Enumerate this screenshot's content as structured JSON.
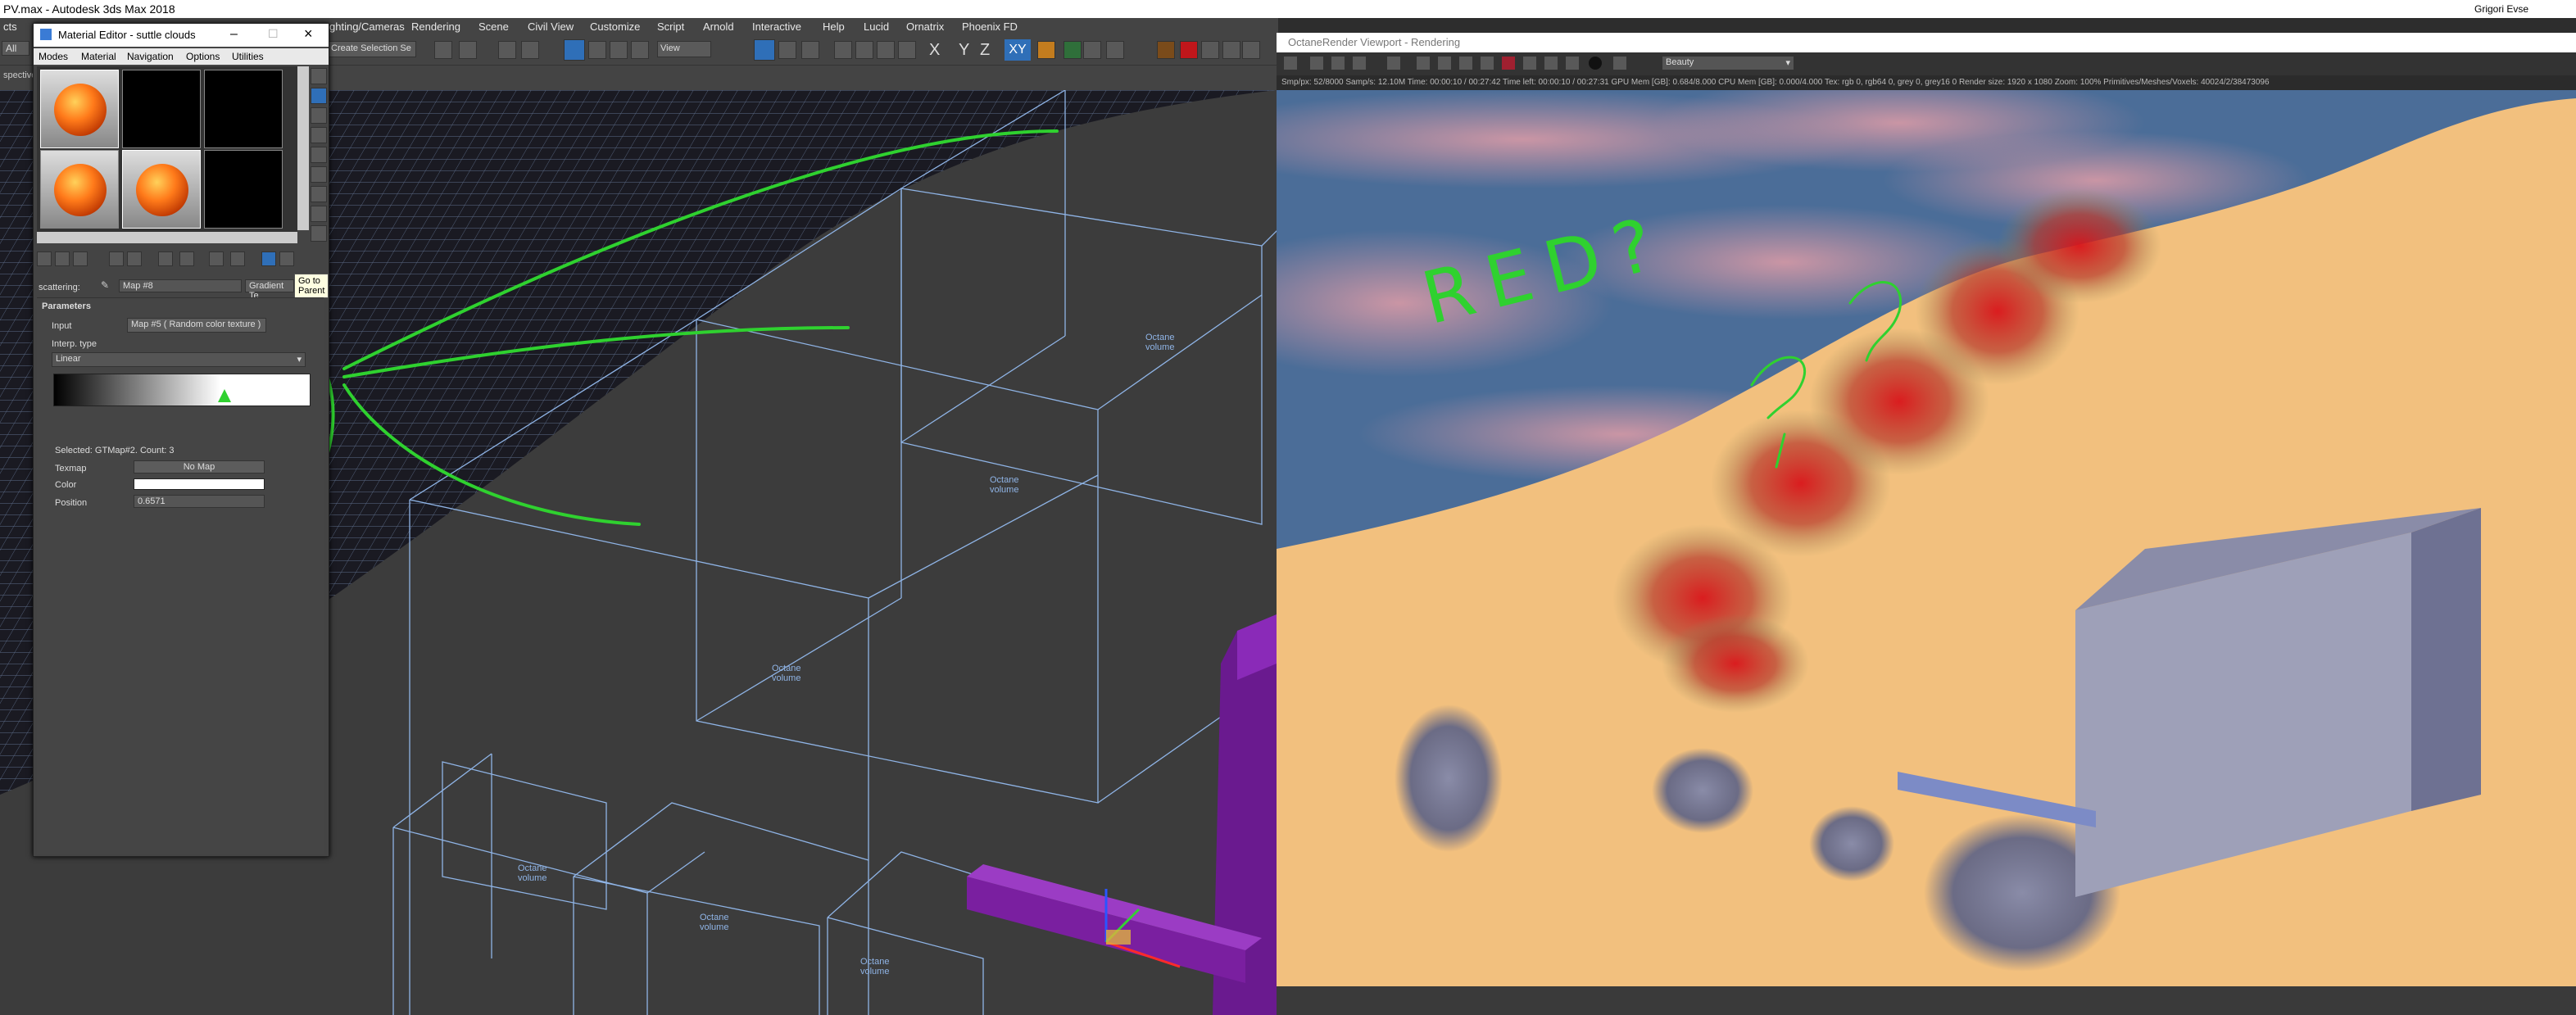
{
  "window": {
    "title": "PV.max - Autodesk 3ds Max 2018",
    "user": "Grigori Evse"
  },
  "menubar": {
    "items": [
      "cts",
      "ghting/Cameras",
      "Rendering",
      "Scene",
      "Civil View",
      "Customize",
      "Script",
      "Arnold",
      "Interactive",
      "Help",
      "Lucid",
      "Ornatrix",
      "Phoenix FD"
    ]
  },
  "toolbar": {
    "all_dropdown": "All",
    "selection_set": "Create Selection Se",
    "view_dropdown": "View",
    "axis_x": "X",
    "axis_y": "Y",
    "axis_z": "Z",
    "axis_xy": "XY"
  },
  "viewport": {
    "label": "spective",
    "volume_labels": [
      "Octane\nvolume",
      "Octane\nvolume",
      "Octane\nvolume",
      "Octane\nvolume",
      "Octane\nvolume",
      "Octane\nvolume"
    ]
  },
  "material_editor": {
    "title": "Material Editor - suttle clouds",
    "menu": [
      "Modes",
      "Material",
      "Navigation",
      "Options",
      "Utilities"
    ],
    "scattering_label": "scattering:",
    "map_name": "Map #8",
    "map_type": "Gradient Te",
    "tooltip": "Go to Parent",
    "rollout_title": "Parameters",
    "input_label": "Input",
    "input_value": "Map #5  ( Random color texture )",
    "interp_label": "Interp. type",
    "interp_value": "Linear",
    "selected_text": "Selected: GTMap#2. Count: 3",
    "texmap_label": "Texmap",
    "texmap_value": "No Map",
    "color_label": "Color",
    "position_label": "Position",
    "position_value": "0.6571"
  },
  "octane": {
    "title": "OctaneRender Viewport - Rendering",
    "pass_dropdown": "Beauty",
    "status": "Smp/px: 52/8000   Samp/s: 12.10M   Time: 00:00:10 / 00:27:42   Time left: 00:00:10 / 00:27:31   GPU Mem [GB]: 0.684/8.000   CPU Mem [GB]: 0.000/4.000   Tex: rgb 0, rgb64 0, grey 0, grey16 0   Render size: 1920 x 1080   Zoom: 100%   Primitives/Meshes/Voxels: 40024/2/38473096",
    "annotation": "RED?",
    "question_marks": [
      "?",
      "?"
    ]
  },
  "colors": {
    "sand": "#f2c07e",
    "sky": "#4b6d98",
    "annotation": "#2fd12f",
    "volume_box": "#8fb4e6",
    "purple_object": "#7a1fa0"
  }
}
